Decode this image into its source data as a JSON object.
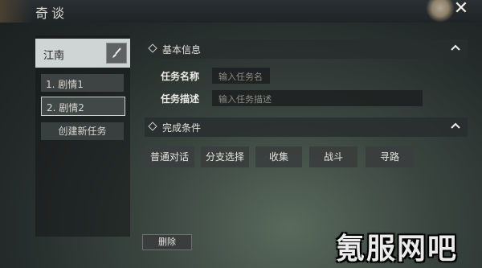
{
  "window": {
    "title": "奇谈",
    "close_icon": "close-icon"
  },
  "sidebar": {
    "region": "江南",
    "tasks": [
      {
        "label": "1. 剧情1",
        "selected": false
      },
      {
        "label": "2. 剧情2",
        "selected": true
      }
    ],
    "create_label": "创建新任务"
  },
  "basic_info": {
    "header": "基本信息",
    "name_label": "任务名称",
    "name_placeholder": "输入任务名",
    "desc_label": "任务描述",
    "desc_placeholder": "输入任务描述"
  },
  "conditions": {
    "header": "完成条件",
    "buttons": [
      "普通对话",
      "分支选择",
      "收集",
      "战斗",
      "寻路"
    ]
  },
  "footer": {
    "delete_label": "删除"
  },
  "watermark": "氪服网吧"
}
